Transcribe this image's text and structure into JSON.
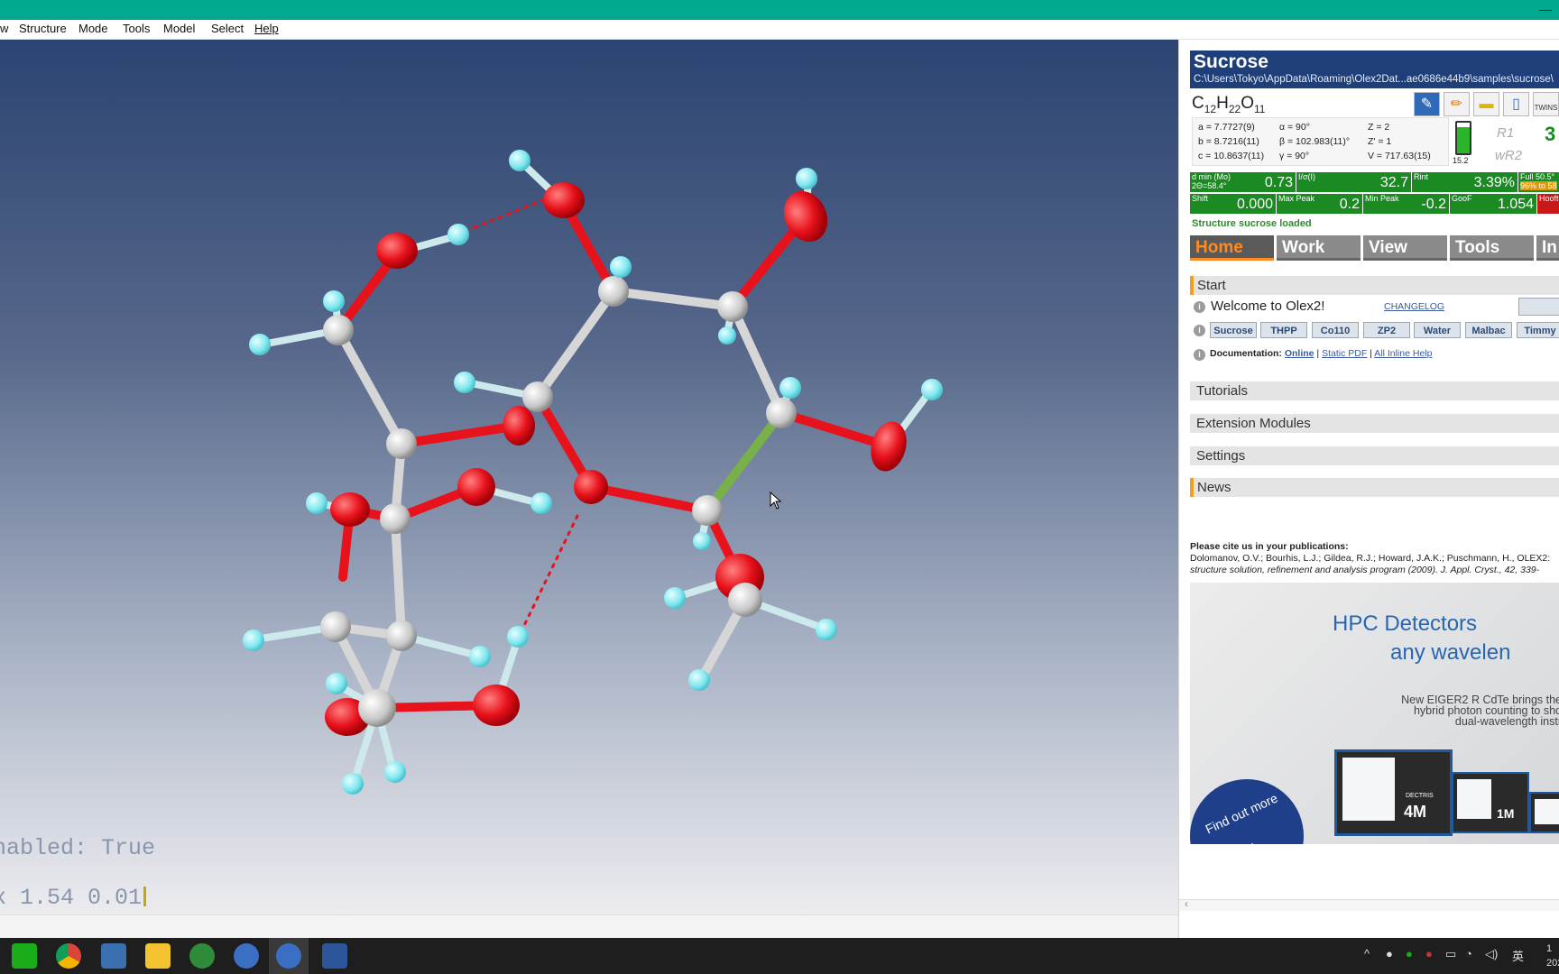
{
  "menu": [
    "w",
    "Structure",
    "Mode",
    "Tools",
    "Model",
    "Select",
    "Help"
  ],
  "console": {
    "line1": "nabled: True",
    "line2": "x 1.54 0.01"
  },
  "header": {
    "title": "Sucrose",
    "path": "C:\\Users\\Tokyo\\AppData\\Roaming\\Olex2Dat...ae0686e44b9\\samples\\sucrose\\"
  },
  "formula": {
    "c": "C",
    "c_n": "12",
    "h": "H",
    "h_n": "22",
    "o": "O",
    "o_n": "11"
  },
  "toolbar_icons": [
    "pencil-blue-icon",
    "pencil-icon",
    "folder-icon",
    "notebook-icon",
    "twins-icon"
  ],
  "twins_label": "TWINS",
  "cell": {
    "a": "a = 7.7727(9)",
    "b": "b = 8.7216(11)",
    "c": "c = 10.8637(11)",
    "alpha": "α = 90°",
    "beta": "β = 102.983(11)°",
    "gamma": "γ = 90°",
    "Z": "Z = 2",
    "Zp": "Z' = 1",
    "V": "V = 717.63(15)"
  },
  "battery_value": "15.2",
  "r_labels": {
    "r1": "R1",
    "wr2": "wR2",
    "r1_value": "3"
  },
  "stats": {
    "dmin_label": "d min (Mo)",
    "dmin_sub": "2Θ=58.4°",
    "dmin": "0.73",
    "isig_label": "I/σ(I)",
    "isig": "32.7",
    "rint_label": "Rint",
    "rint": "3.39%",
    "full_label": "Full 50.5°",
    "full_sub": "96% to 58",
    "shift_label": "Shift",
    "shift": "0.000",
    "maxpeak_label": "Max Peak",
    "maxpeak": "0.2",
    "minpeak_label": "Min Peak",
    "minpeak": "-0.2",
    "goof_label": "GooF",
    "goof": "1.054",
    "hooft_label": "Hooft"
  },
  "status": "Structure sucrose loaded",
  "tabs": [
    "Home",
    "Work",
    "View",
    "Tools",
    "In"
  ],
  "start": {
    "title": "Start",
    "welcome": "Welcome to Olex2!",
    "changelog": "CHANGELOG",
    "samples": [
      "Sucrose",
      "THPP",
      "Co110",
      "ZP2",
      "Water",
      "Malbac",
      "Timmy"
    ],
    "doc_label": "Documentation:",
    "doc_online": "Online",
    "doc_pdf": "Static PDF",
    "doc_inline": "All Inline Help"
  },
  "sections": [
    "Tutorials",
    "Extension Modules",
    "Settings"
  ],
  "news": {
    "title": "News",
    "cite": "Please cite us in your publications:",
    "authors": "Dolomanov, O.V.; Bourhis, L.J.; Gildea, R.J.; Howard, J.A.K.; Puschmann, H., OLEX2:",
    "ref": "structure solution, refinement and analysis program (2009). J. Appl. Cryst., 42, 339-"
  },
  "ad": {
    "line1": "HPC Detectors",
    "line2": "any wavelen",
    "small1": "New EIGER2 R CdTe brings the",
    "small2": "hybrid photon counting to sho",
    "small3": "dual-wavelength instr",
    "cta": "Find out more",
    "brand": "DECTRIS",
    "m4": "4M",
    "m1": "1M"
  },
  "taskbar": {
    "clock_top": "1",
    "clock_bottom": "202",
    "ime": "英"
  },
  "colors": {
    "title_strip": "#00a88e",
    "oxygen": "#e8121c",
    "hydrogen": "#7fe6ee",
    "carbon": "#dcdcdc",
    "header": "#1f3f7a",
    "stat_green": "#1b8a22"
  }
}
